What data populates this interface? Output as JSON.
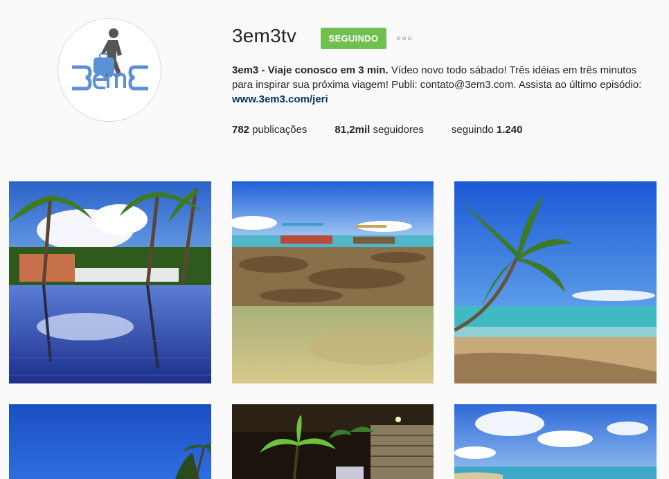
{
  "profile": {
    "username": "3em3tv",
    "follow_button": "SEGUINDO",
    "logo_text": "3em3",
    "bio_name": "3em3 - Viaje conosco em 3 min.",
    "bio_text": " Vídeo novo todo sábado! Três idéias em três minutos para inspirar sua próxima viagem! Publi: contato@3em3.com. Assista ao último episódio: ",
    "bio_link": "www.3em3.com/jeri"
  },
  "stats": {
    "posts_count": "782",
    "posts_label": " publicações",
    "followers_count": "81,2mil",
    "followers_label": " seguidores",
    "following_label": "seguindo ",
    "following_count": "1.240"
  },
  "colors": {
    "follow_green": "#70c050",
    "link_blue": "#003569",
    "logo_blue": "#5b8fd6",
    "logo_gray": "#555555"
  },
  "posts": [
    {
      "name": "post-pool-palms"
    },
    {
      "name": "post-reef-boats"
    },
    {
      "name": "post-palm-beach"
    },
    {
      "name": "post-blue-sky"
    },
    {
      "name": "post-night-palms"
    },
    {
      "name": "post-sea-clouds"
    }
  ]
}
